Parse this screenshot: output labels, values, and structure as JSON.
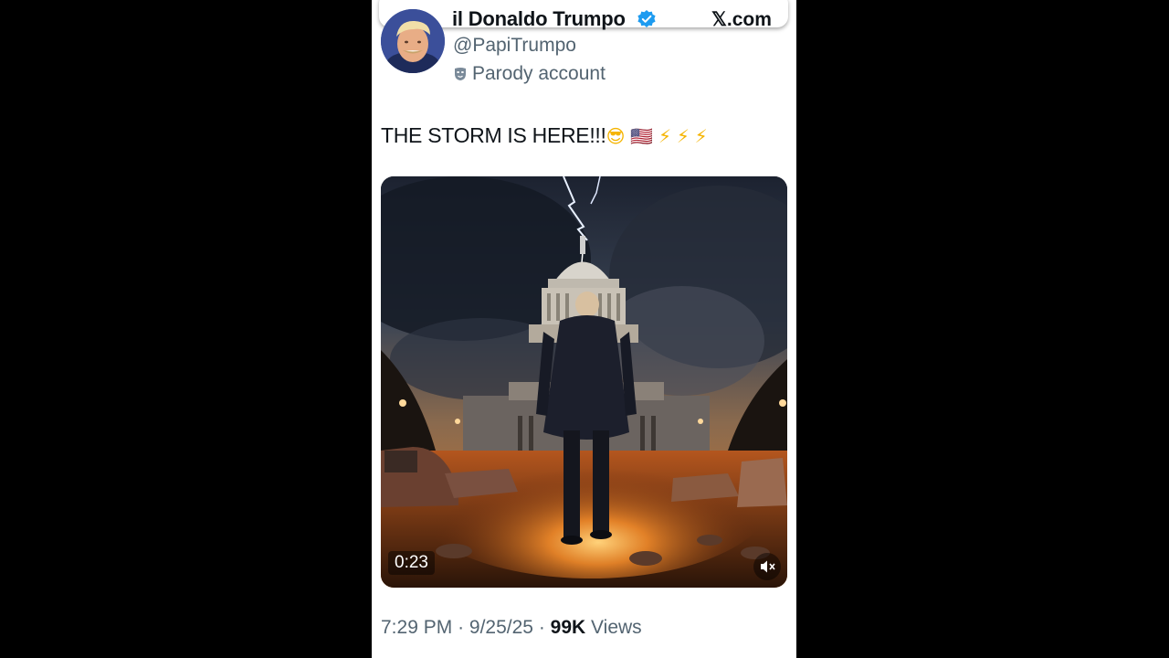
{
  "post": {
    "display_name": "il Donaldo Trumpo",
    "handle": "@PapiTrumpo",
    "parody_label": "Parody account",
    "site_label": "𝕏.com",
    "text": "THE STORM IS HERE!!!",
    "emojis": [
      "😎",
      "🇺🇸",
      "⚡",
      "⚡",
      "⚡"
    ],
    "time": "7:29 PM",
    "date": "9/25/25",
    "views_count": "99K",
    "views_label": "Views",
    "separator": "·"
  },
  "video": {
    "timecode": "0:23"
  },
  "colors": {
    "verified": "#1d9bf0",
    "text_primary": "#0f1419",
    "text_secondary": "#536471",
    "backdrop": "#000000"
  },
  "icons": {
    "verified": "verified-badge-icon",
    "parody": "parody-mask-icon",
    "mute": "muted-speaker-icon"
  }
}
